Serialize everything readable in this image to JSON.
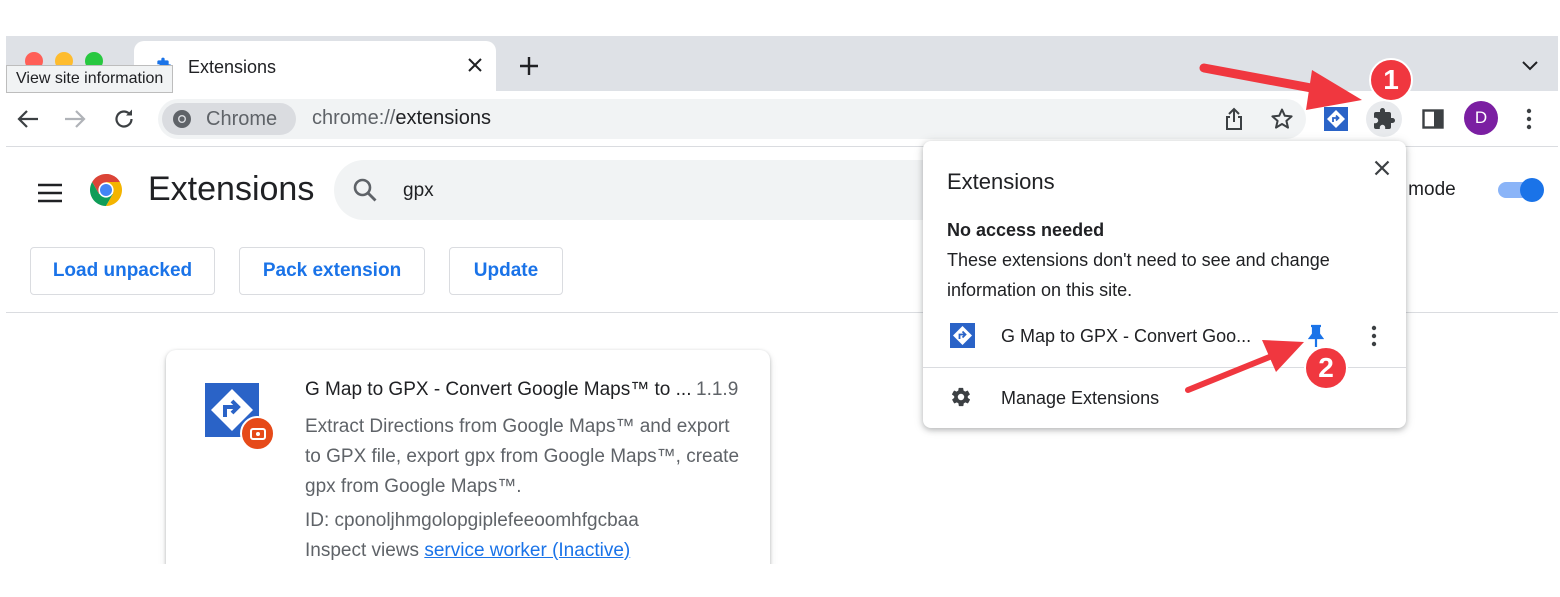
{
  "tooltip": {
    "text": "View site information"
  },
  "tabs": [
    {
      "title": "Extensions"
    }
  ],
  "toolbar": {
    "chip_label": "Chrome",
    "url_scheme": "chrome://",
    "url_host": "extensions",
    "avatar_initial": "D"
  },
  "page": {
    "title": "Extensions",
    "search_value": "gpx",
    "devmode_label": "er mode",
    "devmode_on": true,
    "buttons": {
      "load_unpacked": "Load unpacked",
      "pack_extension": "Pack extension",
      "update": "Update"
    }
  },
  "card": {
    "name": "G Map to GPX - Convert Google Maps™ to ...",
    "version": "1.1.9",
    "description": "Extract Directions from Google Maps™ and export to GPX file, export gpx from Google Maps™, create gpx from Google Maps™.",
    "id_text": "ID: cponoljhmgolopgiplefeeoomhfgcbaa",
    "inspect_label": "Inspect views",
    "inspect_link": "service worker (Inactive)"
  },
  "popup": {
    "title": "Extensions",
    "section_heading": "No access needed",
    "section_desc": "These extensions don't need to see and change information on this site.",
    "extension_name": "G Map to GPX - Convert Goo...",
    "manage_label": "Manage Extensions"
  },
  "annotations": {
    "step1": "1",
    "step2": "2"
  },
  "colors": {
    "accent": "#1a73e8",
    "annotation_red": "#f0373f",
    "ext_icon_blue": "#2a63c7",
    "avatar_purple": "#7b1fa2"
  },
  "icons": [
    "puzzle-icon",
    "star-icon",
    "share-icon",
    "reload-icon",
    "back-arrow-icon",
    "forward-arrow-icon",
    "pin-icon",
    "gear-icon",
    "close-icon",
    "menu-icon",
    "search-icon",
    "more-vert-icon",
    "side-panel-icon",
    "chevron-down-icon",
    "plus-icon"
  ]
}
